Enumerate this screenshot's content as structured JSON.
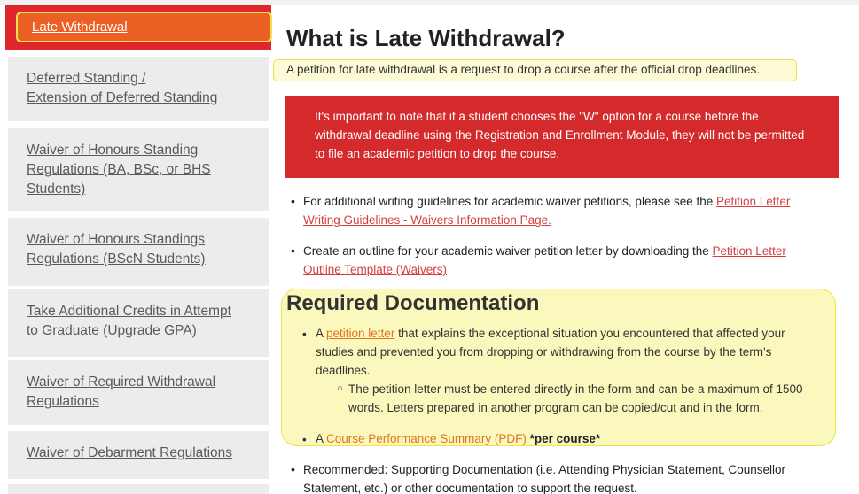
{
  "sidebar": {
    "active": "Late Withdrawal",
    "items": [
      {
        "lines": [
          "Deferred Standing /",
          "Extension of Deferred Standing"
        ]
      },
      {
        "lines": [
          "Waiver of Honours Standing",
          "Regulations (BA, BSc, or BHS",
          "Students)"
        ]
      },
      {
        "lines": [
          "Waiver of Honours Standings",
          "Regulations (BScN Students)"
        ]
      },
      {
        "lines": [
          "Take Additional Credits in Attempt",
          "to Graduate (Upgrade GPA)"
        ]
      },
      {
        "lines": [
          "Waiver of Required Withdrawal",
          "Regulations"
        ]
      },
      {
        "lines": [
          "Waiver of Debarment Regulations"
        ]
      }
    ]
  },
  "main": {
    "title": "What is Late Withdrawal?",
    "intro": "A petition for late withdrawal is a request to drop a course after the official drop deadlines.",
    "alert": "It's important to note that if a student chooses the \"W\" option for a course before the withdrawal deadline using the Registration and Enrollment Module, they will not be permitted to file an academic petition to drop the course.",
    "bullet1_text": "For additional writing guidelines for academic waiver petitions, please see the ",
    "bullet1_link_line1": "Petition Letter",
    "bullet1_link_line2": "Writing Guidelines - Waivers Information Page.",
    "bullet2_text": "Create an outline for your academic waiver petition letter by downloading the ",
    "bullet2_link_line1": "Petition Letter",
    "bullet2_link_line2": "Outline Template (Waivers)",
    "req_title": "Required Documentation",
    "req1_prefix": "A ",
    "req1_link": "petition letter",
    "req1_rest": " that explains the exceptional situation you encountered that affected your",
    "req1_line2": "studies and prevented you from dropping or withdrawing from the course by the term's",
    "req1_line3": "deadlines.",
    "req1_sub_line1": "The petition letter must be entered directly in the form and can be a maximum of 1500",
    "req1_sub_line2": "words. Letters prepared in another program can be copied/cut and in the form.",
    "req2_prefix": "A ",
    "req2_link": "Course Performance Summary (PDF)",
    "req2_bold": " *per course*",
    "rec_line1": "Recommended: Supporting Documentation (i.e. Attending Physician Statement, Counsellor",
    "rec_line2": "Statement, etc.) or other documentation to support the request."
  }
}
